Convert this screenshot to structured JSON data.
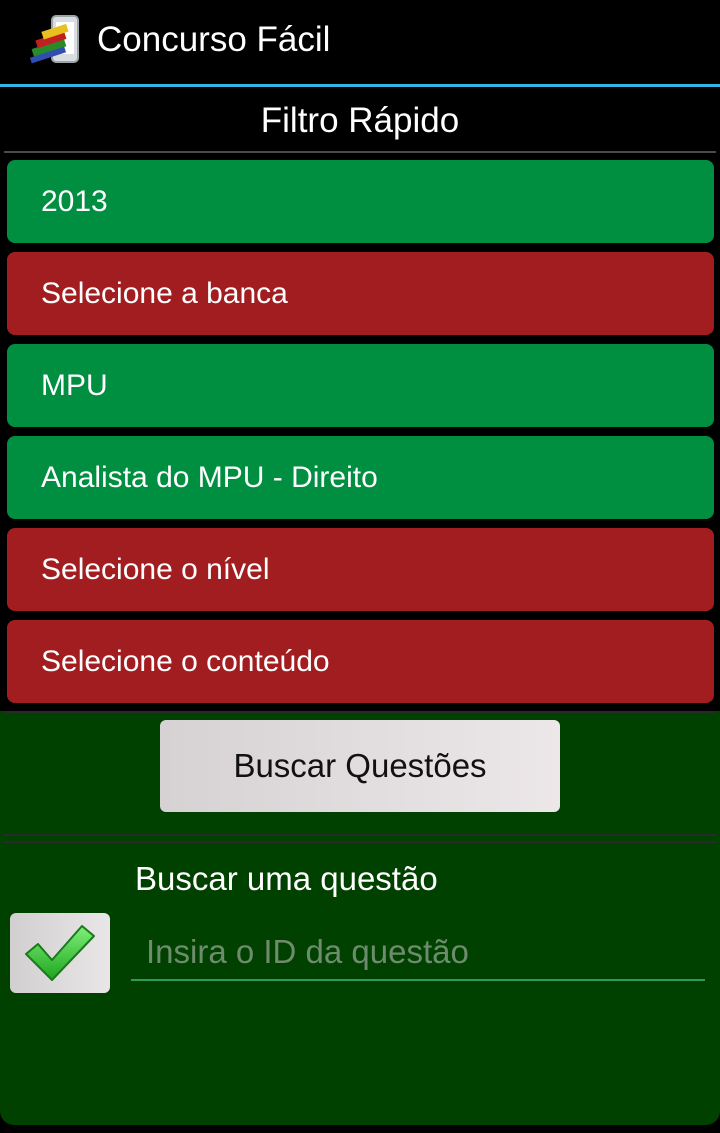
{
  "header": {
    "app_title": "Concurso Fácil",
    "icon": "app-logo-icon",
    "divider_color": "#33b5e5"
  },
  "screen": {
    "subtitle": "Filtro Rápido"
  },
  "filters": [
    {
      "label": "2013",
      "status": "selected",
      "color": "#008e41"
    },
    {
      "label": "Selecione a banca",
      "status": "unselected",
      "color": "#a21d20"
    },
    {
      "label": "MPU",
      "status": "selected",
      "color": "#008e41"
    },
    {
      "label": "Analista do MPU - Direito",
      "status": "selected",
      "color": "#008e41"
    },
    {
      "label": "Selecione o nível",
      "status": "unselected",
      "color": "#a21d20"
    },
    {
      "label": "Selecione o conteúdo",
      "status": "unselected",
      "color": "#a21d20"
    }
  ],
  "actions": {
    "search_button_label": "Buscar Questões"
  },
  "single_search": {
    "label": "Buscar uma questão",
    "input_placeholder": "Insira o ID da questão",
    "input_value": "",
    "confirm_icon": "checkmark-icon"
  }
}
